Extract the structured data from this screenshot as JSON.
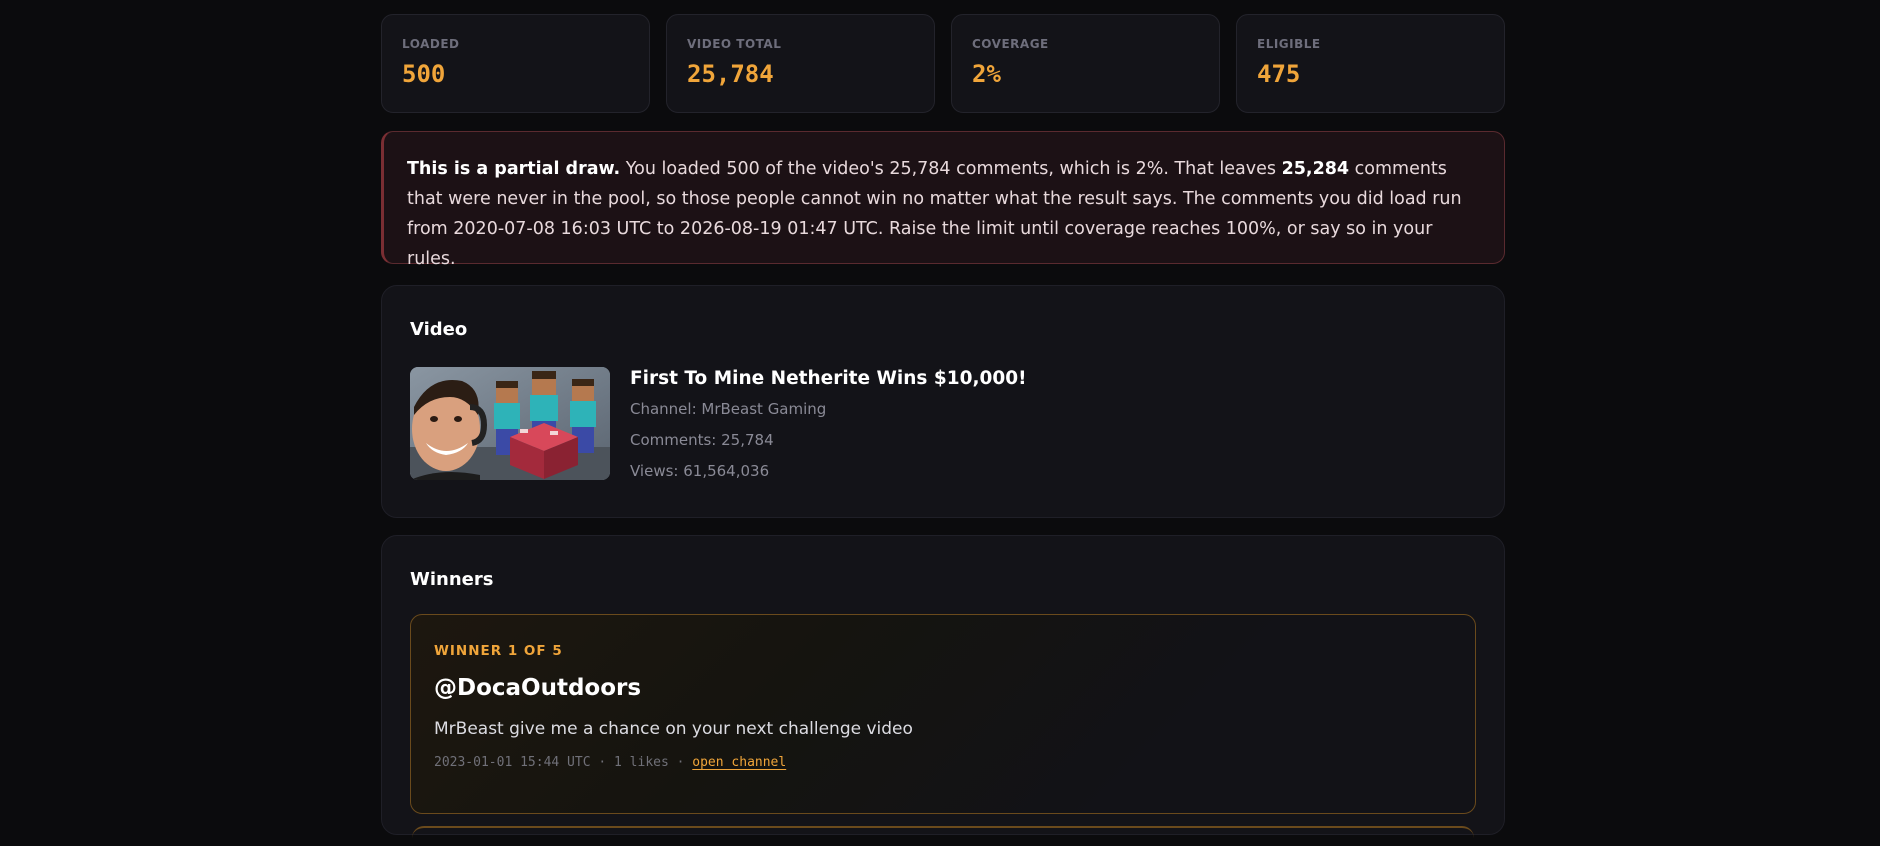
{
  "stats": [
    {
      "label": "LOADED",
      "value": "500"
    },
    {
      "label": "VIDEO TOTAL",
      "value": "25,784"
    },
    {
      "label": "COVERAGE",
      "value": "2%"
    },
    {
      "label": "ELIGIBLE",
      "value": "475"
    }
  ],
  "warning": {
    "lead": "This is a partial draw.",
    "text1": " You loaded 500 of the video's 25,784 comments, which is 2%. That leaves ",
    "missing": "25,284",
    "text2": " comments that were never in the pool, so those people cannot win no matter what the result says. The comments you did load run from 2020-07-08 16:03 UTC to 2026-08-19 01:47 UTC. Raise the limit until coverage reaches 100%, or say so in your rules."
  },
  "video": {
    "section_title": "Video",
    "title": "First To Mine Netherite Wins $10,000!",
    "channel": "Channel: MrBeast Gaming",
    "comments": "Comments: 25,784",
    "views": "Views: 61,564,036"
  },
  "winners": {
    "section_title": "Winners",
    "items": [
      {
        "tag": "WINNER 1 OF 5",
        "handle": "@DocaOutdoors",
        "comment": "MrBeast give me a chance on your next challenge video",
        "meta": "2023-01-01 15:44 UTC · 1 likes · ",
        "link": "open channel"
      }
    ]
  },
  "colors": {
    "accent": "#f0a53a",
    "background": "#0b0b0d",
    "warning_bg": "#1c1115"
  }
}
